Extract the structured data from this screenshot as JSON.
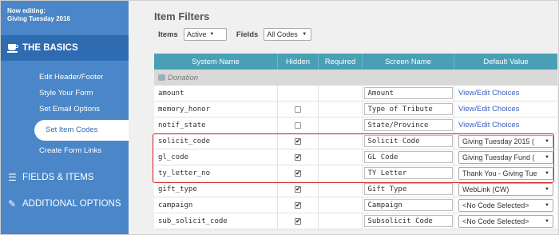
{
  "sidebar": {
    "now_editing_line1": "Now editing:",
    "now_editing_line2": "Giving Tuesday 2016",
    "basics_label": "THE BASICS",
    "basics_items": [
      {
        "label": "Edit Header/Footer"
      },
      {
        "label": "Style Your Form"
      },
      {
        "label": "Set Email Options"
      },
      {
        "label": "Set Item Codes"
      },
      {
        "label": "Create Form Links"
      }
    ],
    "fields_label": "FIELDS & ITEMS",
    "additional_label": "ADDITIONAL OPTIONS"
  },
  "main": {
    "title": "Item Filters",
    "items_label": "Items",
    "items_value": "Active",
    "fields_label": "Fields",
    "fields_value": "All Codes"
  },
  "grid": {
    "headers": [
      "System Name",
      "Hidden",
      "Required",
      "Screen Name",
      "Default Value"
    ],
    "group": "Donation",
    "rows": [
      {
        "system": "amount",
        "hidden": null,
        "screen": "Amount",
        "default": "View/Edit Choices",
        "type": "link"
      },
      {
        "system": "memory_honor",
        "hidden": false,
        "screen": "Type of Tribute",
        "default": "View/Edit Choices",
        "type": "link"
      },
      {
        "system": "notif_state",
        "hidden": false,
        "screen": "State/Province",
        "default": "View/Edit Choices",
        "type": "link"
      },
      {
        "system": "solicit_code",
        "hidden": true,
        "screen": "Solicit Code",
        "default": "Giving Tuesday 2015 (",
        "type": "select"
      },
      {
        "system": "gl_code",
        "hidden": true,
        "screen": "GL Code",
        "default": "Giving Tuesday Fund (",
        "type": "select"
      },
      {
        "system": "ty_letter_no",
        "hidden": true,
        "screen": "TY Letter",
        "default": "Thank You - Giving Tue",
        "type": "select"
      },
      {
        "system": "gift_type",
        "hidden": true,
        "screen": "Gift Type",
        "default": "WebLink (CW)",
        "type": "select"
      },
      {
        "system": "campaign",
        "hidden": true,
        "screen": "Campaign",
        "default": "<No Code Selected>",
        "type": "select"
      },
      {
        "system": "sub_solicit_code",
        "hidden": true,
        "screen": "Subsolicit Code",
        "default": "<No Code Selected>",
        "type": "select"
      }
    ]
  },
  "colors": {
    "sidebar": "#4a86c8",
    "sidebar_active": "#2f6bb0",
    "table_header": "#49a0b5",
    "highlight": "#d32a2a",
    "link": "#3b5fc0"
  },
  "icons": {
    "basics": "coffee-cup-icon",
    "fields": "list-icon",
    "additional": "magic-wand-icon",
    "group": "folder-icon",
    "dropdown": "caret-down-icon"
  }
}
